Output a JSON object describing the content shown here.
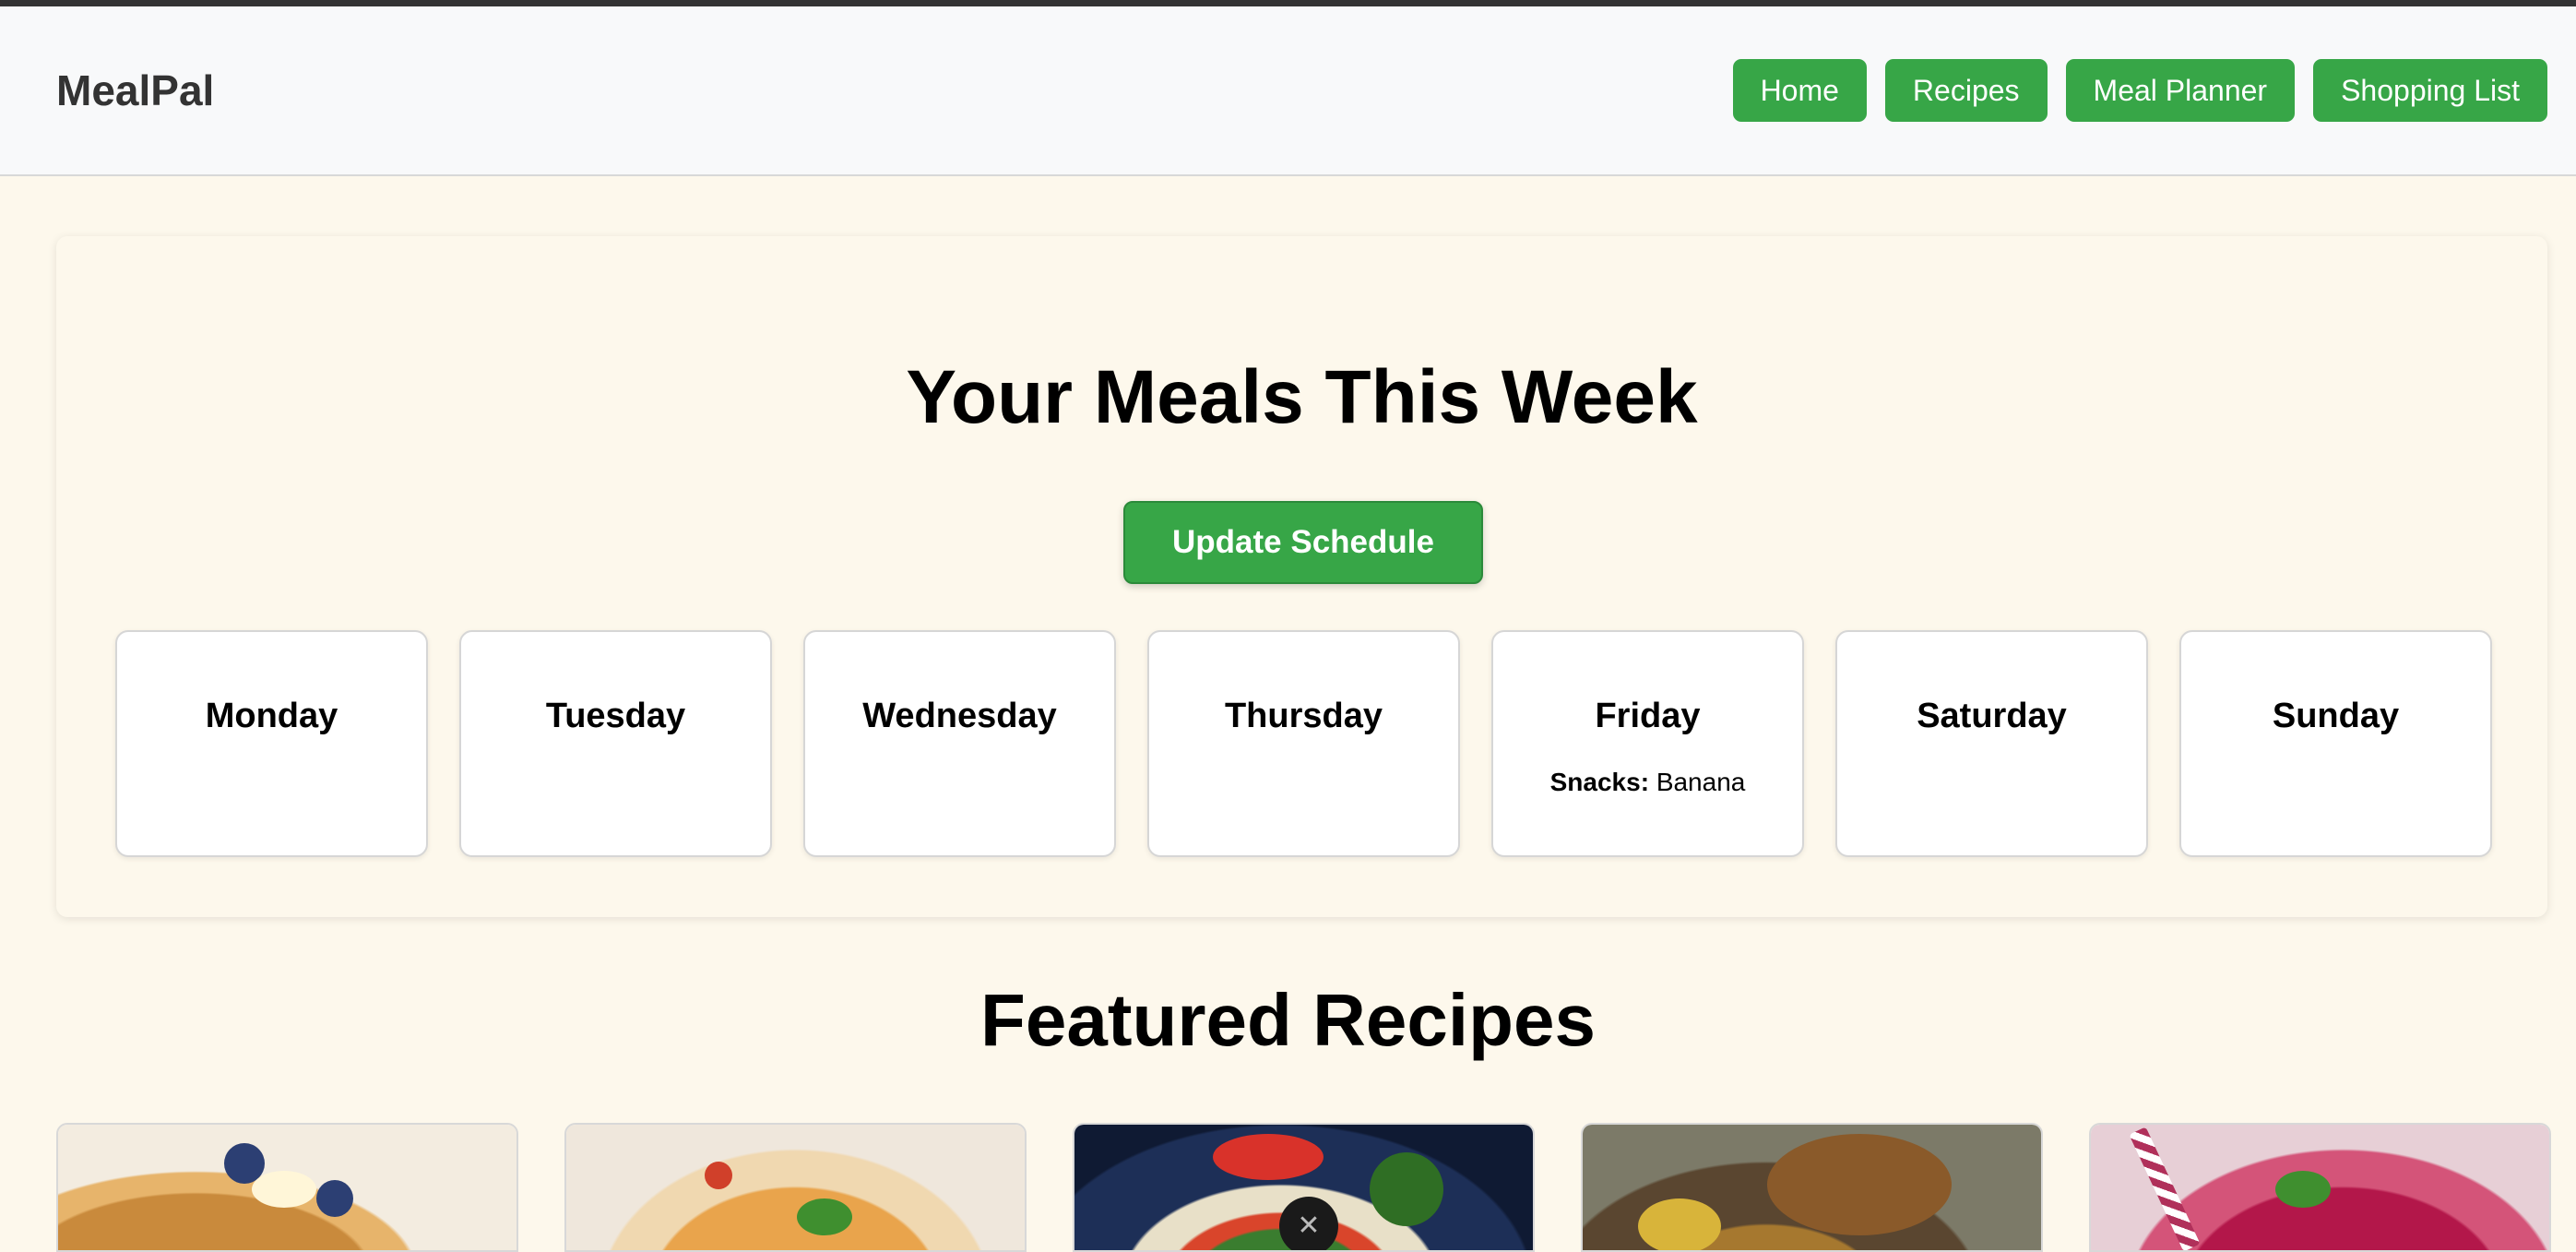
{
  "header": {
    "brand": "MealPal",
    "nav": [
      "Home",
      "Recipes",
      "Meal Planner",
      "Shopping List"
    ]
  },
  "schedule": {
    "title": "Your Meals This Week",
    "update_label": "Update Schedule",
    "days": [
      {
        "name": "Monday"
      },
      {
        "name": "Tuesday"
      },
      {
        "name": "Wednesday"
      },
      {
        "name": "Thursday"
      },
      {
        "name": "Friday",
        "meal_label": "Snacks:",
        "meal_value": "Banana"
      },
      {
        "name": "Saturday"
      },
      {
        "name": "Sunday"
      }
    ]
  },
  "featured": {
    "title": "Featured Recipes"
  },
  "colors": {
    "accent": "#37a647",
    "background": "#fdf8ec",
    "header_bg": "#f8f9fa"
  },
  "icons": {
    "overlay_close": "close-icon"
  }
}
